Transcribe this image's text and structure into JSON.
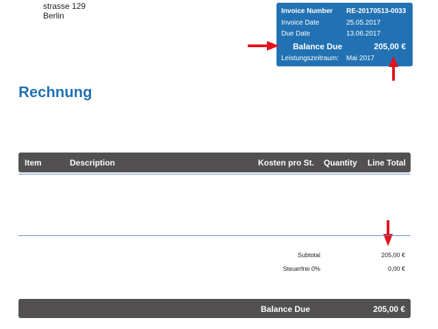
{
  "address": {
    "street": "strasse 129",
    "city": "Berlin"
  },
  "info_box": {
    "invoice_number_label": "Invoice Number",
    "invoice_number": "RE-20170513-0033",
    "invoice_date_label": "Invoice Date",
    "invoice_date": "25.05.2017",
    "due_date_label": "Due Date",
    "due_date": "13.06.2017",
    "balance_due_label": "Balance Due",
    "balance_due": "205,00 €",
    "period_label": "Leistungszeitraum:",
    "period": "Mai 2017"
  },
  "title": "Rechnung",
  "table": {
    "headers": [
      "Item",
      "Description",
      "Kosten pro St.",
      "Quantity",
      "Line Total"
    ]
  },
  "totals": {
    "subtotal_label": "Subtotal",
    "subtotal": "205,00 €",
    "tax_label": "Steuerfrei 0%",
    "tax": "0,00 €"
  },
  "footer": {
    "balance_due_label": "Balance Due",
    "balance_due": "205,00 €"
  },
  "colors": {
    "accent": "#2272b3",
    "header_bg": "#525050",
    "arrow": "#e3121b"
  }
}
